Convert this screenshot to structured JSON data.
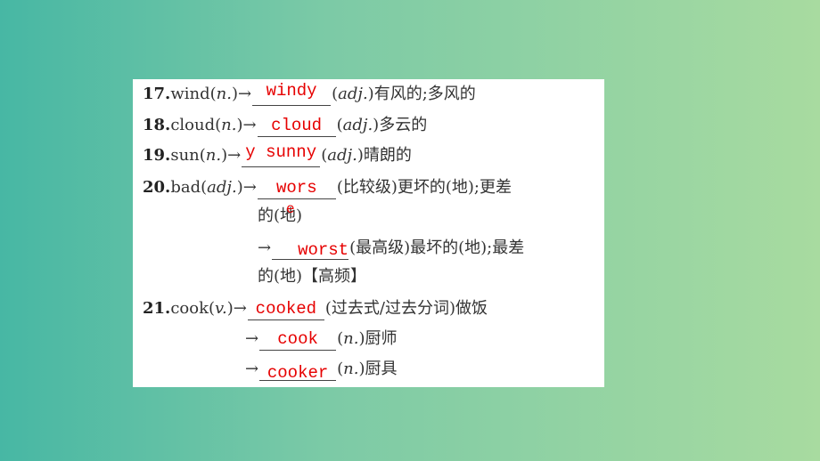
{
  "items": [
    {
      "num": "17.",
      "word": "wind(",
      "pos": "n.",
      "close": ")→",
      "answer": "windy",
      "tail_pos": "adj.",
      "tail": "有风的;多风的"
    },
    {
      "num": "18.",
      "word": "cloud(",
      "pos": "n.",
      "close": ")→",
      "answer": "cloud",
      "tail_pos": "adj.",
      "tail": "多云的"
    },
    {
      "num": "19.",
      "word": "sun(",
      "pos": "n.",
      "close": ")→",
      "answer": "y sunny",
      "tail_pos": "adj.",
      "tail": "晴朗的"
    },
    {
      "num": "20.",
      "word": "bad(",
      "pos": "adj.",
      "close": ")→",
      "answer": "wors",
      "tail": "(比较级)更坏的(地);更差",
      "tail2": "的(地)",
      "stray": "e",
      "sub": {
        "arrow": "→",
        "answer": "worst",
        "tail": "(最高级)最坏的(地);最差",
        "tail2": "的(地)【高频】"
      }
    },
    {
      "num": "21.",
      "word": "cook(",
      "pos": "v.",
      "close": ")→",
      "answer": "cooked",
      "tail": "(过去式/过去分词)做饭",
      "subs": [
        {
          "arrow": "→",
          "answer": "cook",
          "tail_pos": "n.",
          "tail": "厨师"
        },
        {
          "arrow": "→",
          "answer": "cooker",
          "tail_pos": "n.",
          "tail": "厨具"
        }
      ]
    }
  ],
  "colors": {
    "answer": "#e60000",
    "bg_left": "#47b7a4",
    "bg_right": "#a8dba0"
  }
}
